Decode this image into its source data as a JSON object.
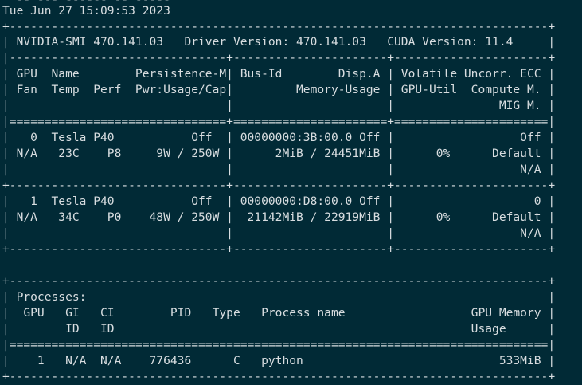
{
  "terminal": {
    "lines": [
      "  -- --- ------ -- -----",
      "Tue Jun 27 15:09:53 2023",
      "+-----------------------------------------------------------------------------+",
      "| NVIDIA-SMI 470.141.03   Driver Version: 470.141.03   CUDA Version: 11.4     |",
      "|-------------------------------+----------------------+----------------------+",
      "| GPU  Name        Persistence-M| Bus-Id        Disp.A | Volatile Uncorr. ECC |",
      "| Fan  Temp  Perf  Pwr:Usage/Cap|         Memory-Usage | GPU-Util  Compute M. |",
      "|                               |                      |               MIG M. |",
      "|===============================+======================+======================|",
      "|   0  Tesla P40           Off  | 00000000:3B:00.0 Off |                  Off |",
      "| N/A   23C    P8     9W / 250W |      2MiB / 24451MiB |      0%      Default |",
      "|                               |                      |                  N/A |",
      "+-------------------------------+----------------------+----------------------+",
      "|   1  Tesla P40           Off  | 00000000:D8:00.0 Off |                    0 |",
      "| N/A   34C    P0    48W / 250W |  21142MiB / 22919MiB |      0%      Default |",
      "|                               |                      |                  N/A |",
      "+-------------------------------+----------------------+----------------------+",
      "",
      "+-----------------------------------------------------------------------------+",
      "| Processes:                                                                  |",
      "|  GPU   GI   CI        PID   Type   Process name                  GPU Memory |",
      "|        ID   ID                                                   Usage      |",
      "|=============================================================================|",
      "|    1   N/A  N/A    776436      C   python                            533MiB |",
      "+-----------------------------------------------------------------------------+"
    ]
  }
}
